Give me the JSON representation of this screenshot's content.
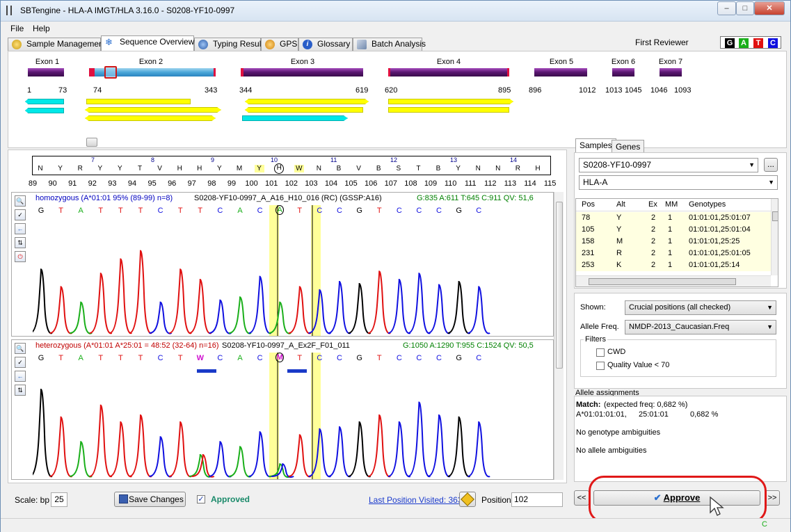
{
  "window": {
    "title": "SBTengine - HLA-A IMGT/HLA 3.16.0 - S0208-YF10-0997"
  },
  "menu": [
    "File",
    "Help"
  ],
  "tabs": [
    {
      "label": "Sample Management",
      "icon": "sample-icon"
    },
    {
      "label": "Sequence Overview",
      "icon": "snowflake-icon",
      "active": true
    },
    {
      "label": "Typing Result",
      "icon": "typing-icon"
    },
    {
      "label": "GPS",
      "icon": "gps-icon"
    },
    {
      "label": "Glossary",
      "icon": "info-icon"
    },
    {
      "label": "Batch Analysis",
      "icon": "batch-icon"
    }
  ],
  "reviewer": "First Reviewer",
  "bases_legend": [
    {
      "letter": "G",
      "color": "#000000"
    },
    {
      "letter": "A",
      "color": "#1aaf1a"
    },
    {
      "letter": "T",
      "color": "#e01010"
    },
    {
      "letter": "C",
      "color": "#1010e0"
    }
  ],
  "exons": [
    {
      "name": "Exon 1",
      "start": "1",
      "end": "73"
    },
    {
      "name": "Exon 2",
      "start": "74",
      "end": "343"
    },
    {
      "name": "Exon 3",
      "start": "344",
      "end": "619"
    },
    {
      "name": "Exon 4",
      "start": "620",
      "end": "895"
    },
    {
      "name": "Exon 5",
      "start": "896",
      "end": "1012"
    },
    {
      "name": "Exon 6",
      "start": "1013",
      "end": "1045"
    },
    {
      "name": "Exon 7",
      "start": "1046",
      "end": "1093"
    }
  ],
  "codons": [
    "7",
    "8",
    "9",
    "10",
    "11",
    "12",
    "13",
    "14"
  ],
  "amino_acids": [
    "N",
    "Y",
    "R",
    "Y",
    "Y",
    "T",
    "V",
    "H",
    "H",
    "Y",
    "M",
    "Y",
    "H",
    "W",
    "N",
    "B",
    "V",
    "B",
    "S",
    "T",
    "B",
    "Y",
    "N",
    "N",
    "R",
    "H"
  ],
  "positions": [
    "89",
    "90",
    "91",
    "92",
    "93",
    "94",
    "95",
    "96",
    "97",
    "98",
    "99",
    "100",
    "101",
    "102",
    "103",
    "104",
    "105",
    "106",
    "107",
    "108",
    "109",
    "110",
    "111",
    "112",
    "113",
    "114",
    "115"
  ],
  "trace1": {
    "title_left": "homozygous (A*01:01  95% (89-99) n=8)",
    "title_mid": "S0208-YF10-0997_A_A16_H10_016 (RC) (GSSP:A16)",
    "title_right": "G:835 A:611 T:645 C:911 QV: 51,6",
    "bases": [
      "G",
      "T",
      "A",
      "T",
      "T",
      "T",
      "C",
      "T",
      "T",
      "C",
      "A",
      "C",
      "A",
      "T",
      "C",
      "C",
      "G",
      "T",
      "C",
      "C",
      "C",
      "G",
      "C"
    ]
  },
  "trace2": {
    "title_left": "heterozygous (A*01:01 A*25:01 = 48:52 (32-64) n=16)",
    "title_mid": "S0208-YF10-0997_A_Ex2F_F01_011",
    "title_right": "G:1050 A:1290 T:955 C:1524 QV: 50,5",
    "bases": [
      "G",
      "T",
      "A",
      "T",
      "T",
      "T",
      "C",
      "T",
      "W",
      "C",
      "A",
      "C",
      "M",
      "T",
      "C",
      "C",
      "G",
      "T",
      "C",
      "C",
      "C",
      "G",
      "C"
    ]
  },
  "right": {
    "tabs": [
      "Samples",
      "Genes"
    ],
    "sample": "S0208-YF10-0997",
    "browse_label": "...",
    "gene": "HLA-A",
    "table_headers": [
      "Pos",
      "Alt",
      "Ex",
      "MM",
      "Genotypes"
    ],
    "table_rows": [
      [
        "78",
        "Y",
        "2",
        "1",
        "01:01:01,25:01:07"
      ],
      [
        "105",
        "Y",
        "2",
        "1",
        "01:01:01,25:01:04"
      ],
      [
        "158",
        "M",
        "2",
        "1",
        "01:01:01,25:25"
      ],
      [
        "231",
        "R",
        "2",
        "1",
        "01:01:01,25:01:05"
      ],
      [
        "253",
        "K",
        "2",
        "1",
        "01:01:01,25:14"
      ]
    ],
    "shown_label": "Shown:",
    "shown_value": "Crucial positions (all checked)",
    "freq_label": "Allele Freq.",
    "freq_value": "NMDP-2013_Caucasian.Freq",
    "filters_label": "Filters",
    "filter_cwd": "CWD",
    "filter_qv": "Quality Value < 70",
    "assign_title": "Allele assignments",
    "match_label": "Match:",
    "match_freq": "(expected freq: 0,682 %)",
    "match_allele1": "A*01:01:01:01,",
    "match_allele2": "25:01:01",
    "match_pct": "0,682 %",
    "no_genotype": "No genotype ambiguities",
    "no_allele": "No allele ambiguities",
    "approve_label": "Approve",
    "prev_label": "<<",
    "next_label": ">>"
  },
  "bottom": {
    "scale_label": "Scale: bp",
    "scale_value": "25",
    "save_label": "Save Changes",
    "approved_label": "Approved",
    "last_visited": "Last Position Visited: 363",
    "position_label": "Position",
    "position_value": "102"
  },
  "status": {
    "indicator": "C"
  }
}
